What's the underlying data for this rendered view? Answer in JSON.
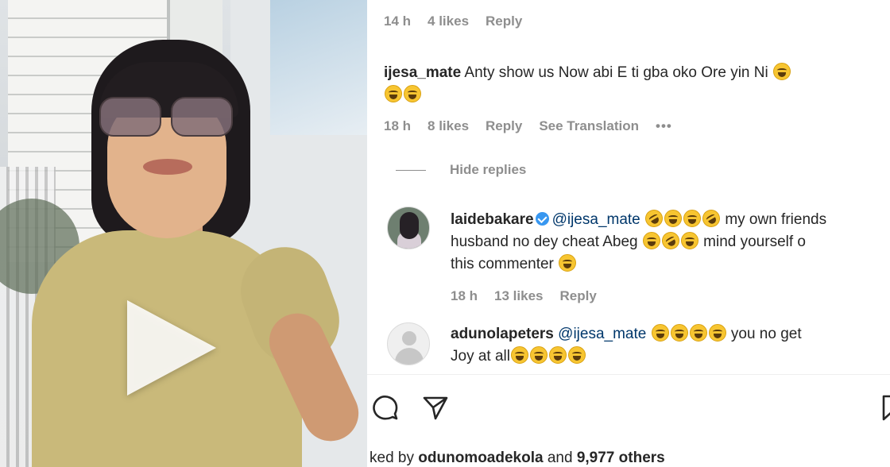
{
  "comments": [
    {
      "meta": {
        "time": "14 h",
        "likes": "4 likes",
        "reply": "Reply"
      }
    },
    {
      "username": "ijesa_mate",
      "text": "Anty show us Now abi E ti gba oko Ore yin Ni",
      "meta": {
        "time": "18 h",
        "likes": "8 likes",
        "reply": "Reply",
        "translate": "See Translation",
        "more": "•••"
      }
    }
  ],
  "hide_replies": "Hide replies",
  "replies": [
    {
      "username": "laidebakare",
      "verified": true,
      "mention": "@ijesa_mate",
      "text_1": "my own friends",
      "text_2": "husband no dey cheat Abeg",
      "text_3": "mind yourself o",
      "text_4": "this commenter",
      "meta": {
        "time": "18 h",
        "likes": "13 likes",
        "reply": "Reply"
      }
    },
    {
      "username": "adunolapeters",
      "mention": "@ijesa_mate",
      "text_1": "you no get",
      "text_2": "Joy at all"
    }
  ],
  "footer": {
    "liked_prefix": "ked by",
    "liked_user": "odunomoadekola",
    "liked_and": "and",
    "liked_count": "9,977 others"
  },
  "icons": {
    "video_play": "play-icon",
    "comment": "comment-icon",
    "share": "share-icon",
    "bookmark": "bookmark-icon",
    "emoji": "laughing-emoji"
  }
}
